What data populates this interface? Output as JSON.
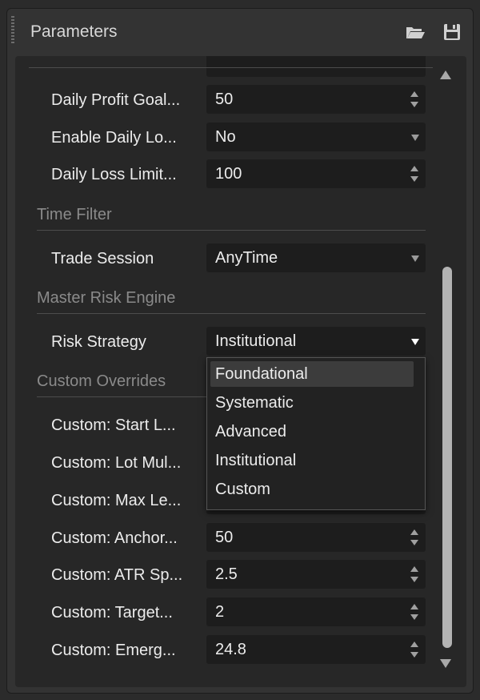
{
  "panel": {
    "title": "Parameters"
  },
  "rows_top": [
    {
      "label": "Daily Profit Goal...",
      "value": "50",
      "control": "spin"
    },
    {
      "label": "Enable Daily Lo...",
      "value": "No",
      "control": "select"
    },
    {
      "label": "Daily Loss Limit...",
      "value": "100",
      "control": "spin"
    }
  ],
  "sections": {
    "time_filter": "Time Filter",
    "master_risk": "Master Risk Engine",
    "custom_overrides": "Custom Overrides"
  },
  "trade_session": {
    "label": "Trade Session",
    "value": "AnyTime"
  },
  "risk_strategy": {
    "label": "Risk Strategy",
    "value": "Institutional",
    "options": [
      "Foundational",
      "Systematic",
      "Advanced",
      "Institutional",
      "Custom"
    ],
    "highlighted": "Foundational"
  },
  "custom_rows": [
    {
      "label": "Custom: Start L...",
      "value": ""
    },
    {
      "label": "Custom: Lot Mul...",
      "value": ""
    },
    {
      "label": "Custom: Max Le...",
      "value": ""
    },
    {
      "label": "Custom: Anchor...",
      "value": "50"
    },
    {
      "label": "Custom: ATR Sp...",
      "value": "2.5"
    },
    {
      "label": "Custom: Target...",
      "value": "2"
    },
    {
      "label": "Custom: Emerg...",
      "value": "24.8"
    }
  ],
  "icons": {
    "open": "folder-open-icon",
    "save": "floppy-disk-icon"
  }
}
